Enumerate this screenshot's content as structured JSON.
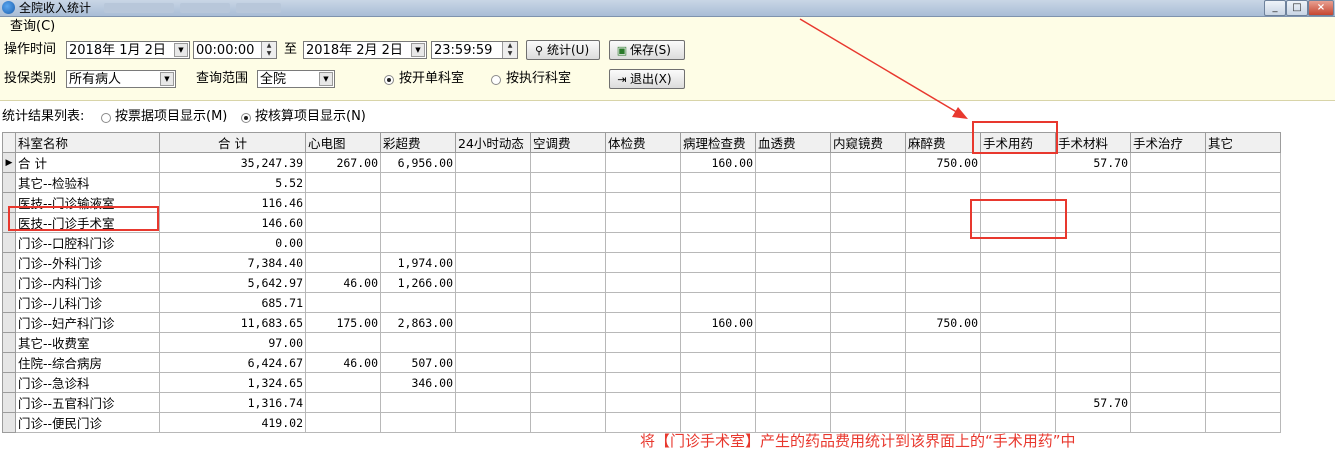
{
  "window": {
    "title": "全院收入统计",
    "controls": [
      "_",
      "□",
      "×"
    ]
  },
  "query": {
    "group_label": "查询(C)",
    "op_time_label": "操作时间",
    "start_date": "2018年 1月 2日",
    "start_time": "00:00:00",
    "to_label": "至",
    "end_date": "2018年 2月 2日",
    "end_time": "23:59:59",
    "insurance_label": "投保类别",
    "insurance_value": "所有病人",
    "scope_label": "查询范围",
    "scope_value": "全院",
    "radio_billing_dept": "按开单科室",
    "radio_exec_dept": "按执行科室",
    "btn_stats": "统计(U)",
    "btn_save": "保存(S)",
    "btn_exit": "退出(X)"
  },
  "list_options": {
    "label": "统计结果列表:",
    "radio_ticket_items": "按票据项目显示(M)",
    "radio_accounting_items": "按核算项目显示(N)"
  },
  "table": {
    "columns": [
      "科室名称",
      "合  计",
      "心电图",
      "彩超费",
      "24小时动态",
      "空调费",
      "体检费",
      "病理检查费",
      "血透费",
      "内窥镜费",
      "麻醉费",
      "手术用药",
      "手术材料",
      "手术治疗",
      "其它"
    ],
    "rows": [
      [
        "合 计",
        "35,247.39",
        "267.00",
        "6,956.00",
        "",
        "",
        "",
        "160.00",
        "",
        "",
        "750.00",
        "",
        "57.70",
        "",
        ""
      ],
      [
        "其它--检验科",
        "5.52",
        "",
        "",
        "",
        "",
        "",
        "",
        "",
        "",
        "",
        "",
        "",
        "",
        ""
      ],
      [
        "医技--门诊输液室",
        "116.46",
        "",
        "",
        "",
        "",
        "",
        "",
        "",
        "",
        "",
        "",
        "",
        "",
        ""
      ],
      [
        "医技--门诊手术室",
        "146.60",
        "",
        "",
        "",
        "",
        "",
        "",
        "",
        "",
        "",
        "",
        "",
        "",
        ""
      ],
      [
        "门诊--口腔科门诊",
        "0.00",
        "",
        "",
        "",
        "",
        "",
        "",
        "",
        "",
        "",
        "",
        "",
        "",
        ""
      ],
      [
        "门诊--外科门诊",
        "7,384.40",
        "",
        "1,974.00",
        "",
        "",
        "",
        "",
        "",
        "",
        "",
        "",
        "",
        "",
        ""
      ],
      [
        "门诊--内科门诊",
        "5,642.97",
        "46.00",
        "1,266.00",
        "",
        "",
        "",
        "",
        "",
        "",
        "",
        "",
        "",
        "",
        ""
      ],
      [
        "门诊--儿科门诊",
        "685.71",
        "",
        "",
        "",
        "",
        "",
        "",
        "",
        "",
        "",
        "",
        "",
        "",
        ""
      ],
      [
        "门诊--妇产科门诊",
        "11,683.65",
        "175.00",
        "2,863.00",
        "",
        "",
        "",
        "160.00",
        "",
        "",
        "750.00",
        "",
        "",
        "",
        ""
      ],
      [
        "其它--收费室",
        "97.00",
        "",
        "",
        "",
        "",
        "",
        "",
        "",
        "",
        "",
        "",
        "",
        "",
        ""
      ],
      [
        "住院--综合病房",
        "6,424.67",
        "46.00",
        "507.00",
        "",
        "",
        "",
        "",
        "",
        "",
        "",
        "",
        "",
        "",
        ""
      ],
      [
        "门诊--急诊科",
        "1,324.65",
        "",
        "346.00",
        "",
        "",
        "",
        "",
        "",
        "",
        "",
        "",
        "",
        "",
        ""
      ],
      [
        "门诊--五官科门诊",
        "1,316.74",
        "",
        "",
        "",
        "",
        "",
        "",
        "",
        "",
        "",
        "",
        "57.70",
        "",
        ""
      ],
      [
        "门诊--便民门诊",
        "419.02",
        "",
        "",
        "",
        "",
        "",
        "",
        "",
        "",
        "",
        "",
        "",
        "",
        ""
      ]
    ]
  },
  "annotation": {
    "text": "将【门诊手术室】产生的药品费用统计到该界面上的“手术用药”中",
    "color": "#e8382e"
  }
}
